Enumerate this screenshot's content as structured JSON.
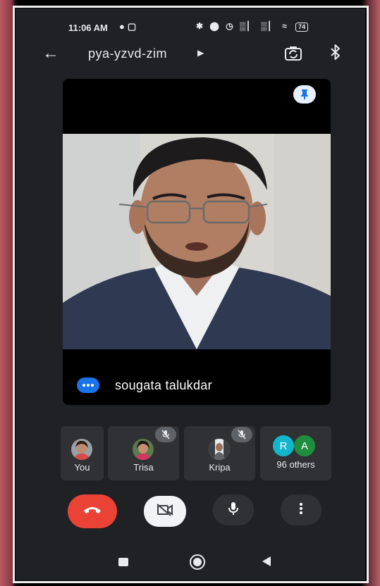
{
  "status_bar": {
    "time": "11:06 AM",
    "battery": "74"
  },
  "top_bar": {
    "meeting_code": "pya-yzvd-zim"
  },
  "main_tile": {
    "participant_name": "sougata talukdar"
  },
  "participants": [
    {
      "label": "You"
    },
    {
      "label": "Trisa",
      "muted": true
    },
    {
      "label": "Kripa",
      "muted": true
    },
    {
      "label": "96 others",
      "initials": [
        "R",
        "A"
      ]
    }
  ],
  "colors": {
    "end_call": "#ea4335",
    "accent_blue": "#1a73e8",
    "avatar_r": "#12b5cb",
    "avatar_a": "#1e8e3e",
    "background": "#202124",
    "tile": "#303134"
  },
  "icons": {
    "back": "arrow-left-icon",
    "switch_camera": "switch-camera-icon",
    "bluetooth": "bluetooth-icon",
    "pin": "pin-icon",
    "end_call": "phone-hangup-icon",
    "camera_off": "video-off-icon",
    "mic": "microphone-icon",
    "more": "more-vertical-icon"
  }
}
